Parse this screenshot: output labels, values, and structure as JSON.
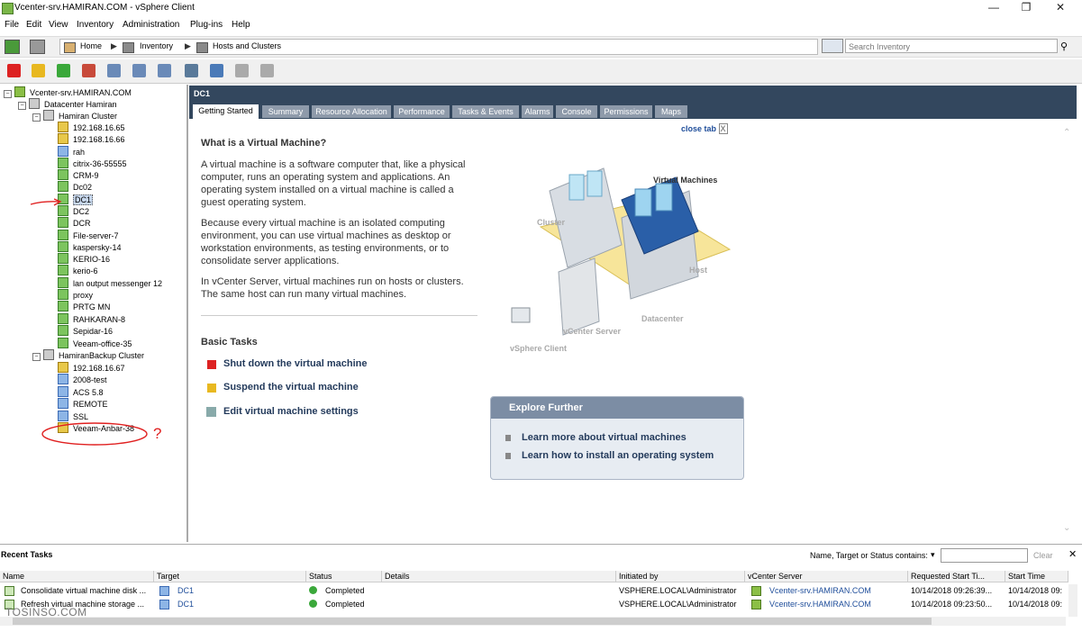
{
  "window": {
    "title": "Vcenter-srv.HAMIRAN.COM - vSphere Client",
    "minimize": "—",
    "maximize": "❐",
    "close": "✕"
  },
  "menu": [
    "File",
    "Edit",
    "View",
    "Inventory",
    "Administration",
    "Plug-ins",
    "Help"
  ],
  "nav": {
    "crumbs": [
      "Home",
      "Inventory",
      "Hosts and Clusters"
    ],
    "search_placeholder": "Search Inventory"
  },
  "tree": {
    "root": "Vcenter-srv.HAMIRAN.COM",
    "datacenter": "Datacenter Hamiran",
    "cluster1": "Hamiran Cluster",
    "cluster1_items": [
      "192.168.16.65",
      "192.168.16.66",
      "rah",
      "citrix-36-55555",
      "CRM-9",
      "Dc02",
      "DC1",
      "DC2",
      "DCR",
      "File-server-7",
      "kaspersky-14",
      "KERIO-16",
      "kerio-6",
      "lan output messenger 12",
      "proxy",
      "PRTG MN",
      "RAHKARAN-8",
      "Sepidar-16",
      "Veeam-office-35"
    ],
    "cluster2": "HamiranBackup Cluster",
    "cluster2_items": [
      "192.168.16.67",
      "2008-test",
      "ACS 5.8",
      "REMOTE",
      "SSL",
      "Veeam-Anbar-38"
    ],
    "question_mark": "?"
  },
  "main": {
    "title": "DC1",
    "tabs": [
      "Getting Started",
      "Summary",
      "Resource Allocation",
      "Performance",
      "Tasks & Events",
      "Alarms",
      "Console",
      "Permissions",
      "Maps"
    ],
    "close_tab": "close tab",
    "close_tab_x": "X",
    "heading": "What is a Virtual Machine?",
    "paragraphs": [
      "A virtual machine is a software computer that, like a physical computer, runs an operating system and applications. An operating system installed on a virtual machine is called a guest operating system.",
      "Because every virtual machine is an isolated computing environment, you can use virtual machines as desktop or workstation environments, as testing environments, or to consolidate server applications.",
      "In vCenter Server, virtual machines run on hosts or clusters. The same host can run many virtual machines."
    ],
    "diagram": {
      "virtual_machines": "Virtual Machines",
      "cluster": "Cluster",
      "host": "Host",
      "datacenter": "Datacenter",
      "vcenter": "vCenter Server",
      "vsphere": "vSphere Client"
    },
    "basic_tasks": "Basic Tasks",
    "tasks": [
      "Shut down the virtual machine",
      "Suspend the virtual machine",
      "Edit virtual machine settings"
    ],
    "explore": {
      "title": "Explore Further",
      "links": [
        "Learn more about virtual machines",
        "Learn how to install an operating system"
      ]
    }
  },
  "recent": {
    "title": "Recent Tasks",
    "filter_label": "Name, Target or Status contains:",
    "clear": "Clear",
    "columns": [
      "Name",
      "Target",
      "Status",
      "Details",
      "Initiated by",
      "vCenter Server",
      "Requested Start Ti...",
      "Start Time"
    ],
    "rows": [
      [
        "Consolidate virtual machine disk ...",
        "DC1",
        "Completed",
        "",
        "VSPHERE.LOCAL\\Administrator",
        "Vcenter-srv.HAMIRAN.COM",
        "10/14/2018 09:26:39...",
        "10/14/2018 09:"
      ],
      [
        "Refresh virtual machine storage ...",
        "DC1",
        "Completed",
        "",
        "VSPHERE.LOCAL\\Administrator",
        "Vcenter-srv.HAMIRAN.COM",
        "10/14/2018 09:23:50...",
        "10/14/2018 09:"
      ]
    ]
  },
  "watermark": "TOSINSO.COM",
  "colors": {
    "header": "#33475e",
    "tab": "#8e9aaa",
    "link": "#1e4d9a",
    "annotation": "#e02020"
  }
}
